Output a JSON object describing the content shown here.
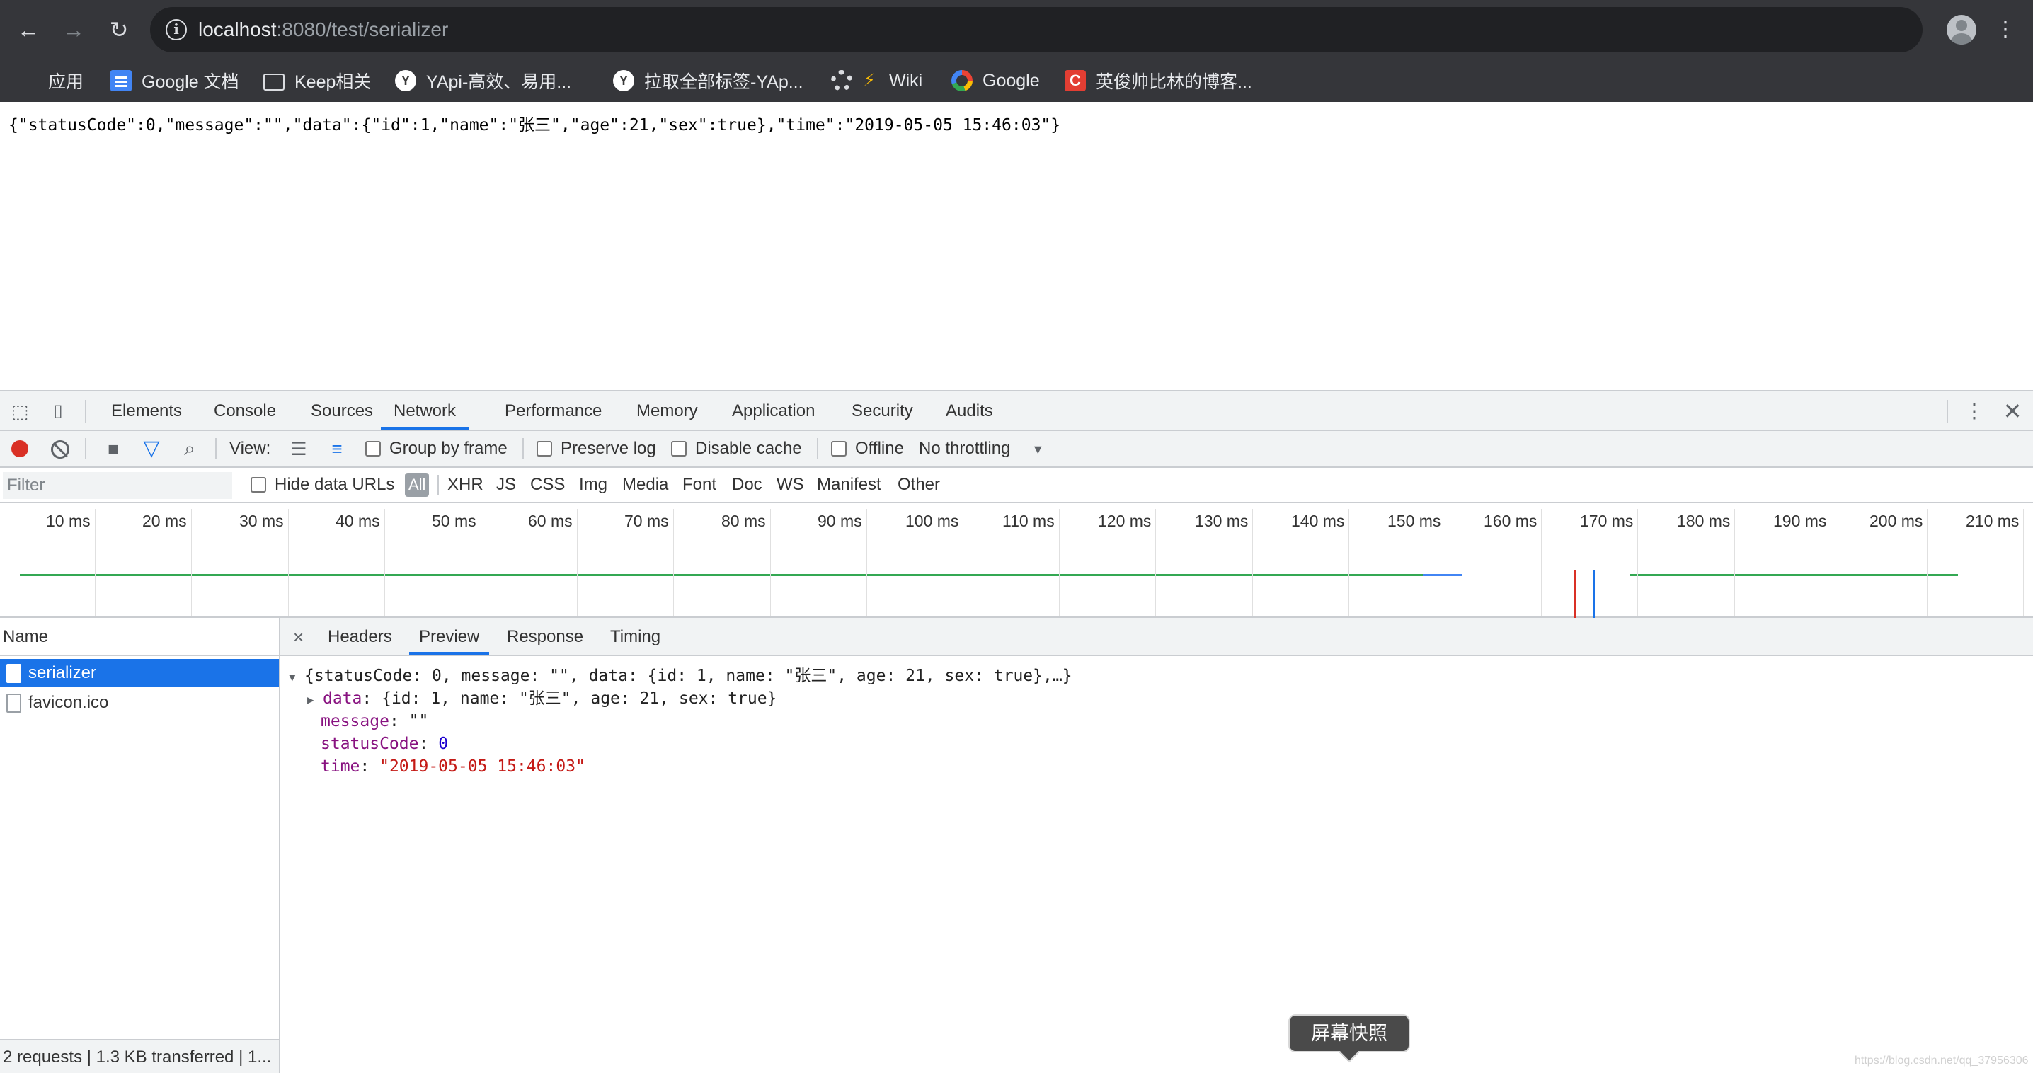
{
  "browser": {
    "url_host": "localhost",
    "url_rest": ":8080/test/serializer",
    "bookmarks": [
      {
        "label": "应用",
        "icon": "apps-icon"
      },
      {
        "label": "Google 文档",
        "icon": "google-docs-icon"
      },
      {
        "label": "Keep相关",
        "icon": "folder-icon"
      },
      {
        "label": "YApi-高效、易用...",
        "icon": "yapi-icon"
      },
      {
        "label": "拉取全部标签-YAp...",
        "icon": "yapi-icon"
      },
      {
        "label": "Wiki",
        "icon": "gear-icon"
      },
      {
        "label": "Google",
        "icon": "google-icon"
      },
      {
        "label": "英俊帅比林的博客...",
        "icon": "csdn-icon"
      }
    ]
  },
  "page": {
    "json_text": "{\"statusCode\":0,\"message\":\"\",\"data\":{\"id\":1,\"name\":\"张三\",\"age\":21,\"sex\":true},\"time\":\"2019-05-05 15:46:03\"}"
  },
  "devtools": {
    "tabs": [
      "Elements",
      "Console",
      "Sources",
      "Network",
      "Performance",
      "Memory",
      "Application",
      "Security",
      "Audits"
    ],
    "active_tab": "Network",
    "toolbar": {
      "view_label": "View:",
      "group_by_frame": "Group by frame",
      "preserve_log": "Preserve log",
      "disable_cache": "Disable cache",
      "offline": "Offline",
      "throttling": "No throttling"
    },
    "filter": {
      "placeholder": "Filter",
      "hide_data_urls": "Hide data URLs",
      "types": [
        "All",
        "XHR",
        "JS",
        "CSS",
        "Img",
        "Media",
        "Font",
        "Doc",
        "WS",
        "Manifest",
        "Other"
      ]
    },
    "timeline_ticks": [
      "10 ms",
      "20 ms",
      "30 ms",
      "40 ms",
      "50 ms",
      "60 ms",
      "70 ms",
      "80 ms",
      "90 ms",
      "100 ms",
      "110 ms",
      "120 ms",
      "130 ms",
      "140 ms",
      "150 ms",
      "160 ms",
      "170 ms",
      "180 ms",
      "190 ms",
      "200 ms",
      "210 ms"
    ],
    "name_header": "Name",
    "requests": [
      "serializer",
      "favicon.ico"
    ],
    "status": "2 requests | 1.3 KB transferred | 1...",
    "detail_tabs": [
      "Headers",
      "Preview",
      "Response",
      "Timing"
    ],
    "close_symbol": "×",
    "preview": {
      "summary": "{statusCode: 0, message: \"\", data: {id: 1, name: \"张三\", age: 21, sex: true},…}",
      "data_key": "data",
      "data_value": "{id: 1, name: \"张三\", age: 21, sex: true}",
      "message_key": "message",
      "message_value": "\"\"",
      "status_key": "statusCode",
      "status_value": "0",
      "time_key": "time",
      "time_value": "\"2019-05-05 15:46:03\""
    }
  },
  "tooltip": "屏幕快照",
  "watermark": "https://blog.csdn.net/qq_37956306"
}
